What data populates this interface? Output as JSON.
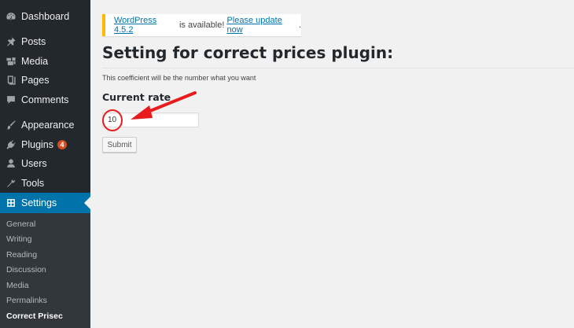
{
  "sidebar": {
    "items": [
      {
        "label": "Dashboard",
        "icon": "dashboard-icon"
      },
      {
        "label": "Posts",
        "icon": "pin-icon"
      },
      {
        "label": "Media",
        "icon": "media-icon"
      },
      {
        "label": "Pages",
        "icon": "pages-icon"
      },
      {
        "label": "Comments",
        "icon": "comment-icon"
      },
      {
        "label": "Appearance",
        "icon": "brush-icon"
      },
      {
        "label": "Plugins",
        "icon": "plugin-icon",
        "badge": "4"
      },
      {
        "label": "Users",
        "icon": "user-icon"
      },
      {
        "label": "Tools",
        "icon": "wrench-icon"
      },
      {
        "label": "Settings",
        "icon": "settings-icon",
        "current": true
      }
    ],
    "submenu": [
      "General",
      "Writing",
      "Reading",
      "Discussion",
      "Media",
      "Permalinks",
      "Correct Prisec"
    ],
    "submenu_current": "Correct Prisec"
  },
  "notice": {
    "link1": "WordPress 4.5.2",
    "middle": " is available! ",
    "link2": "Please update now",
    "end": "."
  },
  "page": {
    "title": "Setting for correct prices plugin:",
    "description": "This coefficient will be the number what you want",
    "field_label": "Current rate",
    "input_value": "10",
    "submit_label": "Submit"
  },
  "colors": {
    "sidebar_bg": "#23282d",
    "submenu_bg": "#32373c",
    "accent": "#0073aa",
    "notice_border": "#ffba00",
    "annotation": "#e81c1c"
  }
}
